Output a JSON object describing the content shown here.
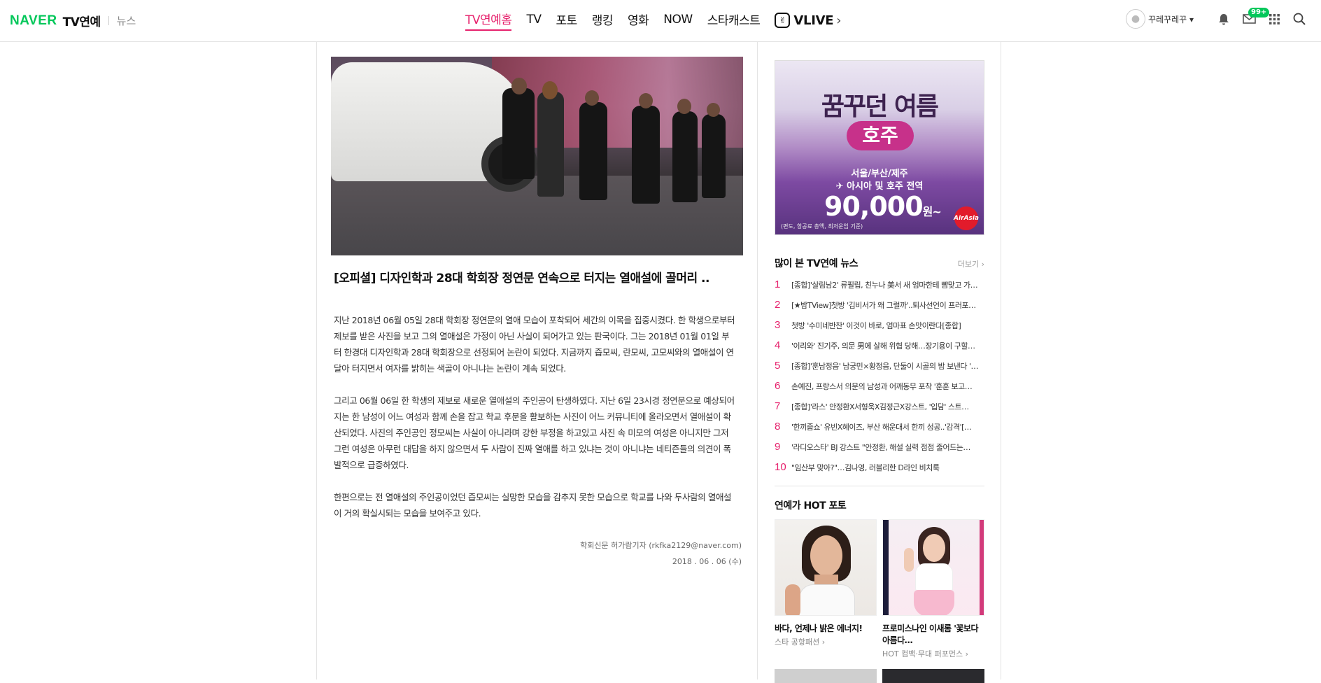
{
  "header": {
    "brand": "NAVER",
    "section": "TV연예",
    "sub": "뉴스",
    "nav": [
      "TV연예홈",
      "TV",
      "포토",
      "랭킹",
      "영화",
      "NOW",
      "스타캐스트"
    ],
    "vlive": "VLIVE",
    "user_name": "꾸레꾸레꾸",
    "mail_badge": "99+"
  },
  "article": {
    "title": "[오피셜] 디자인학과 28대 학회장 정연문 연속으로 터지는 열애설에 골머리 ..",
    "paragraphs": [
      "지난 2018년 06월 05일 28대 학회장 정연문의 열애 모습이 포착되어 세간의 이목을 집중시켰다. 한 학생으로부터 제보를 받은 사진을 보고 그의 열애설은 가정이 아닌 사실이 되어가고 있는 판국이다. 그는 2018년 01월 01일 부터 한경대 디자인학과 28대 학회장으로 선정되어 논란이 되었다. 지금까지 즙모씨, 란모씨, 고모씨와의 열애설이 연달아 터지면서 여자를 밝히는 색골이 아니냐는 논란이 계속 되었다.",
      "그리고 06월 06일 한 학생의 제보로 새로운 열애설의 주인공이 탄생하였다. 지난 6일 23시경 정연문으로 예상되어지는 한 남성이 어느 여성과 함께 손을 잡고 학교 후문을 활보하는 사진이 어느 커뮤니티에 올라오면서 열애설이 확산되었다. 사진의 주인공인 정모씨는 사실이 아니라며 강한 부정을 하고있고 사진 속 미모의 여성은 아니지만 그저 그런 여성은 아무런 대답을 하지 않으면서 두 사람이 진짜 열애를 하고 있냐는 것이 아니냐는 네티즌들의 의견이 폭발적으로 급증하였다.",
      "한편으로는 전 열애설의 주인공이었던 즙모씨는 실망한 모습을 감추지 못한 모습으로 학교를 나와 두사람의 열애설이 거의 확실시되는 모습을 보여주고 있다."
    ],
    "reporter": "학회신문 허가람기자 (rkfka2129@naver.com)",
    "date": "2018 . 06 . 06 (수)"
  },
  "ad": {
    "headline": "꿈꾸던 여름",
    "pill": "호주",
    "line1": "서울/부산/제주",
    "line2": "✈ 아시아 및 호주 전역",
    "price": "90,000",
    "price_unit": "원~",
    "note": "(편도, 항공료 총액, 최저운임 기준)",
    "logo": "AirAsia"
  },
  "ranking": {
    "title": "많이 본 TV연예 뉴스",
    "more": "더보기 ›",
    "items": [
      {
        "n": "1",
        "t": "[종합]'살림남2' 류필립, 친누나 美서 새 엄마한테 뺨맞고 가…"
      },
      {
        "n": "2",
        "t": "[★밤TView]첫방 '김비서가 왜 그럴까'..퇴사선언이 프러포…"
      },
      {
        "n": "3",
        "t": "첫방 '수미네반찬' 이것이 바로, 엄마표 손맛이란다[종합]"
      },
      {
        "n": "4",
        "t": "'이리와' 진기주, 의문 男에 살해 위협 당해…장기용이 구할…"
      },
      {
        "n": "5",
        "t": "[종합]'훈남정음' 남궁민×황정음, 단둘이 시골의 밤 보낸다 '…"
      },
      {
        "n": "6",
        "t": "손예진, 프랑스서 의문의 남성과 어깨동무 포착 '훈훈 보고…"
      },
      {
        "n": "7",
        "t": "[종합]'라스' 안정환X서형욱X김정근X강스트, '입담' 스트…"
      },
      {
        "n": "8",
        "t": "'한끼줍쇼' 유빈X혜이즈, 부산 해운대서 한끼 성공..'감격'[…"
      },
      {
        "n": "9",
        "t": "'라디오스타' BJ 강스트 \"안정환, 해설 실력 점점 줄어드는…"
      },
      {
        "n": "10",
        "t": "\"임산부 맞아?\"…김나영, 러블리한 D라인 비치룩"
      }
    ]
  },
  "photos": {
    "title": "연예가 HOT 포토",
    "items": [
      {
        "caption": "바다, 언제나 밝은 에너지!",
        "tag": "스타 공항패션 ›"
      },
      {
        "caption": "프로미스나인 이새롬 '꽃보다 아름다…",
        "tag": "HOT 컴백·무대 퍼포먼스 ›"
      }
    ]
  },
  "colors": {
    "accent": "#e6216c",
    "naver_green": "#03c75a"
  }
}
